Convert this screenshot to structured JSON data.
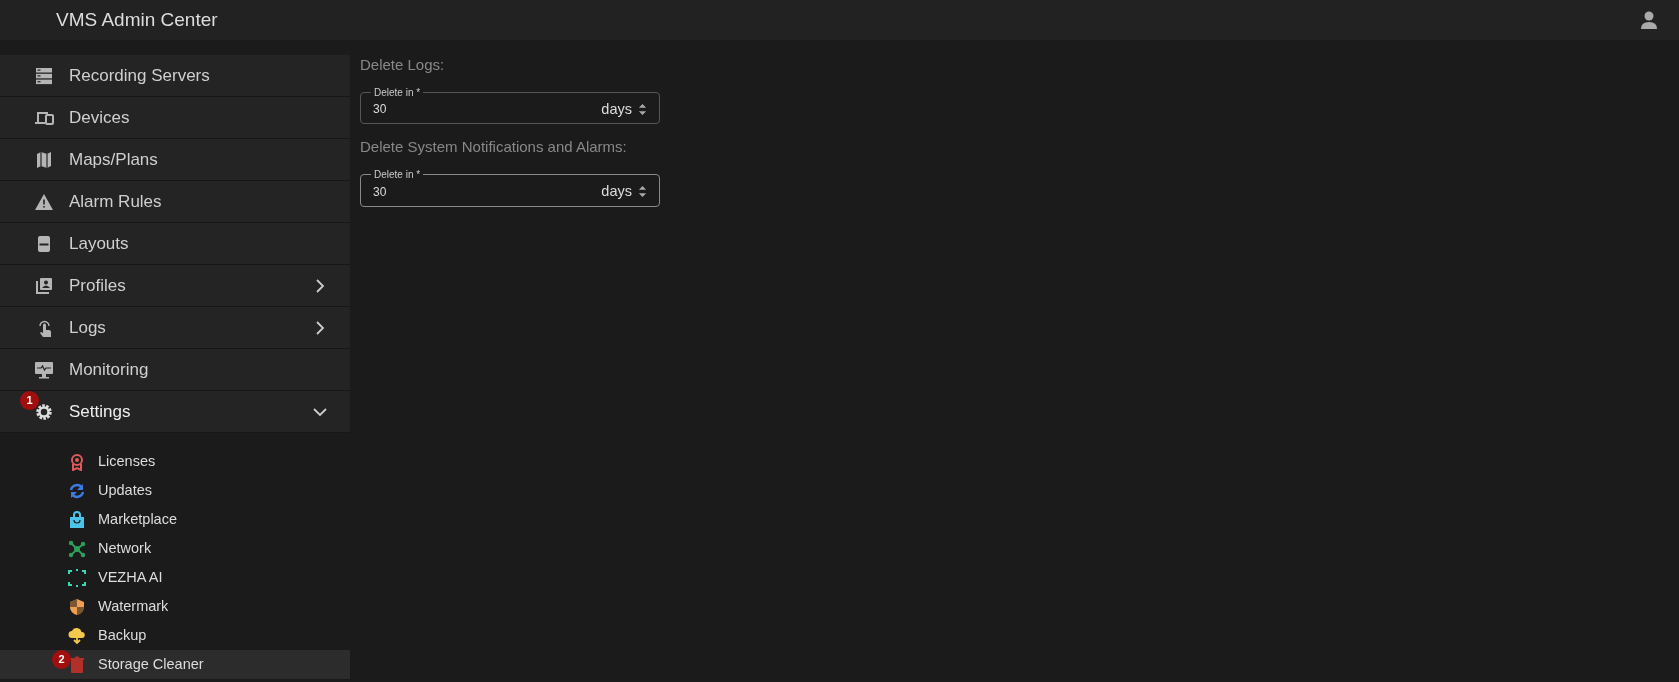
{
  "header": {
    "title": "VMS Admin Center"
  },
  "sidebar": {
    "items": [
      {
        "label": "Recording Servers",
        "expandable": false,
        "expanded": false
      },
      {
        "label": "Devices",
        "expandable": false,
        "expanded": false
      },
      {
        "label": "Maps/Plans",
        "expandable": false,
        "expanded": false
      },
      {
        "label": "Alarm Rules",
        "expandable": false,
        "expanded": false
      },
      {
        "label": "Layouts",
        "expandable": false,
        "expanded": false
      },
      {
        "label": "Profiles",
        "expandable": true,
        "expanded": false
      },
      {
        "label": "Logs",
        "expandable": true,
        "expanded": false
      },
      {
        "label": "Monitoring",
        "expandable": false,
        "expanded": false
      },
      {
        "label": "Settings",
        "expandable": true,
        "expanded": true,
        "badge": "1",
        "children": [
          {
            "label": "Licenses",
            "color": "#e05a5a",
            "selected": false
          },
          {
            "label": "Updates",
            "color": "#3a7be0",
            "selected": false
          },
          {
            "label": "Marketplace",
            "color": "#4cc3e8",
            "selected": false
          },
          {
            "label": "Network",
            "color": "#2e9e5b",
            "selected": false
          },
          {
            "label": "VEZHA AI",
            "color": "#3ed6b8",
            "selected": false
          },
          {
            "label": "Watermark",
            "color": "#f0a050",
            "selected": false
          },
          {
            "label": "Backup",
            "color": "#f2c94c",
            "selected": false
          },
          {
            "label": "Storage Cleaner",
            "color": "#b0302a",
            "selected": true,
            "badge": "2"
          }
        ]
      }
    ]
  },
  "sections": [
    {
      "heading": "Delete Logs:",
      "field": {
        "label": "Delete in *",
        "value": "30",
        "unit": "days",
        "focused": false
      }
    },
    {
      "heading": "Delete System Notifications and Alarms:",
      "field": {
        "label": "Delete in *",
        "value": "30",
        "unit": "days",
        "focused": true
      }
    }
  ]
}
